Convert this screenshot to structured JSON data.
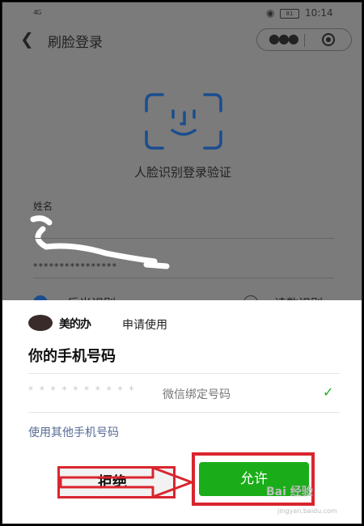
{
  "status_bar": {
    "signal": "4G",
    "battery": "81",
    "time": "10:14"
  },
  "header": {
    "title": "刷脸登录"
  },
  "face_section": {
    "caption": "人脸识别登录验证"
  },
  "form": {
    "name_label": "姓名",
    "id_masked": "****************",
    "option_1": "反光识别",
    "option_2": "读数识别"
  },
  "sheet": {
    "app_name": "美的办",
    "request_text": "申请使用",
    "title": "你的手机号码",
    "phone_masked": "* * * * * * * * * *",
    "phone_tag": "微信绑定号码",
    "other_phone": "使用其他手机号码",
    "reject": "拒绝",
    "allow": "允许"
  },
  "watermark": {
    "text": "Bai 经验",
    "sub": "jingyan.baidu.com"
  },
  "colors": {
    "accent_green": "#1aad19",
    "highlight_red": "#d9252e",
    "link_blue": "#576b95",
    "face_blue": "#1a4d8f"
  }
}
